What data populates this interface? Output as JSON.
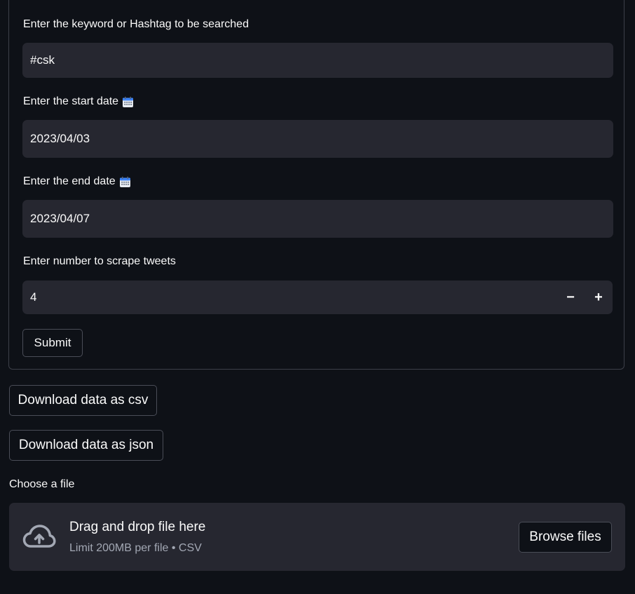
{
  "form": {
    "keyword": {
      "label": "Enter the keyword or Hashtag to be searched",
      "value": "#csk"
    },
    "start_date": {
      "label": "Enter the start date",
      "icon": "calendar-icon",
      "value": "2023/04/03"
    },
    "end_date": {
      "label": "Enter the end date",
      "icon": "calendar-icon",
      "value": "2023/04/07"
    },
    "count": {
      "label": "Enter number to scrape tweets",
      "value": "4",
      "decrement": "−",
      "increment": "+"
    },
    "submit_label": "Submit"
  },
  "downloads": {
    "csv_label": "Download data as csv",
    "json_label": "Download data as json"
  },
  "uploader": {
    "label": "Choose a file",
    "title": "Drag and drop file here",
    "subtitle": "Limit 200MB per file • CSV",
    "browse_label": "Browse files",
    "icon": "cloud-upload-icon"
  },
  "colors": {
    "background": "#0e1117",
    "input_bg": "#262730",
    "border": "#3d4049",
    "text": "#fafafa",
    "muted_text": "#a3a8b4",
    "calendar_accent": "#3b82f6"
  }
}
